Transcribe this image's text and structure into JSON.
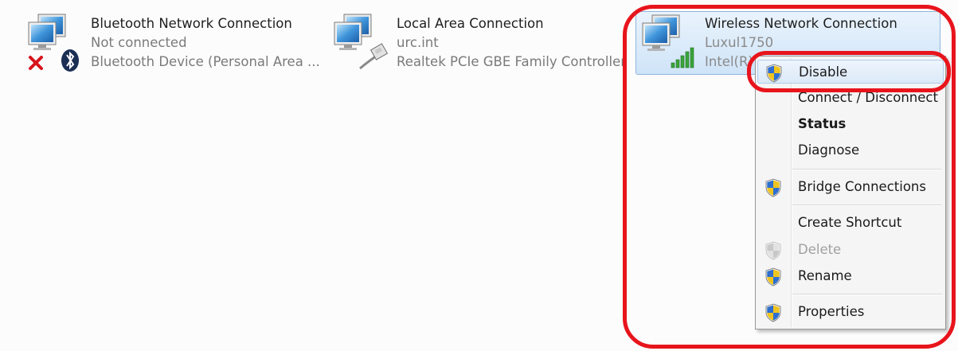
{
  "connections": [
    {
      "name": "Bluetooth Network Connection",
      "status": "Not connected",
      "device": "Bluetooth Device (Personal Area ..."
    },
    {
      "name": "Local Area Connection",
      "status": "urc.int",
      "device": "Realtek PCIe GBE Family Controller"
    },
    {
      "name": "Wireless Network Connection",
      "status": "Luxul1750",
      "device": "Intel(R)"
    }
  ],
  "context_menu": {
    "items": [
      {
        "label": "Disable",
        "shield": true,
        "state": "highlighted"
      },
      {
        "label": "Connect / Disconnect",
        "shield": false
      },
      {
        "label": "Status",
        "shield": false,
        "bold": true
      },
      {
        "label": "Diagnose",
        "shield": false
      },
      {
        "label": "Bridge Connections",
        "shield": true
      },
      {
        "label": "Create Shortcut",
        "shield": false
      },
      {
        "label": "Delete",
        "shield": true,
        "state": "disabled"
      },
      {
        "label": "Rename",
        "shield": true
      },
      {
        "label": "Properties",
        "shield": true
      }
    ]
  },
  "colors": {
    "annotation": "#e8141c",
    "selection": "#cfe4f8",
    "status_text": "#7a7a7a"
  },
  "icons": [
    "network-adapter-icon",
    "red-x-icon",
    "bluetooth-icon",
    "ethernet-cable-icon",
    "wifi-signal-icon",
    "uac-shield-icon"
  ]
}
